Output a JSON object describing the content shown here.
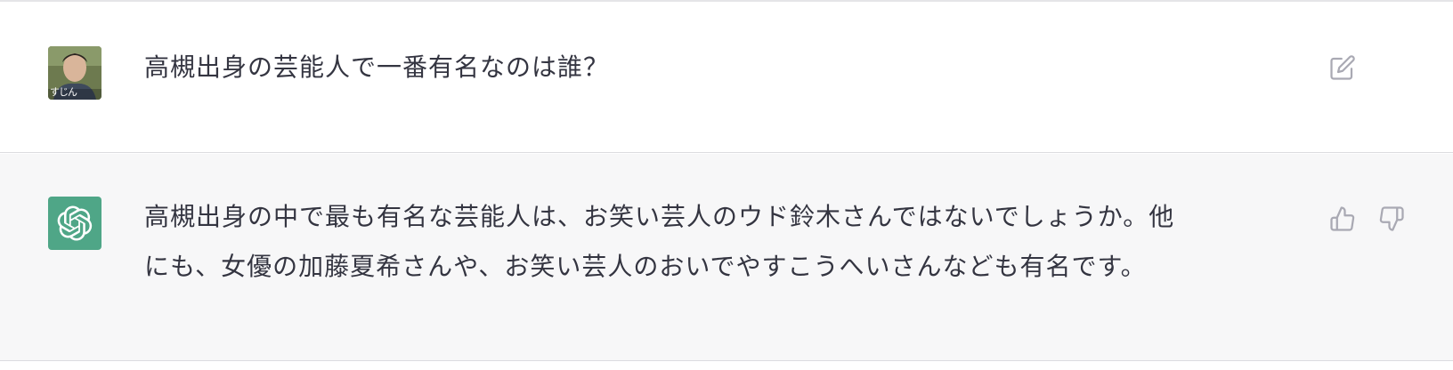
{
  "conversation": {
    "user_message": {
      "avatar_caption": "すじん",
      "text": "高槻出身の芸能人で一番有名なのは誰？"
    },
    "assistant_message": {
      "lines": [
        "高槻出身の中で最も有名な芸能人は、お笑い芸人のウド鈴木さんではないでしょうか。他",
        "にも、女優の加藤夏希さんや、お笑い芸人のおいでやすこうへいさんなども有名です。"
      ]
    }
  },
  "icons": {
    "edit": "edit-icon",
    "like": "thumbs-up-icon",
    "dislike": "thumbs-down-icon",
    "bot_logo": "openai-logo-icon"
  },
  "colors": {
    "bot_avatar_bg": "#4fa687",
    "assistant_row_bg": "#f7f7f8",
    "text": "#343541",
    "icon": "#a9a9b3"
  }
}
